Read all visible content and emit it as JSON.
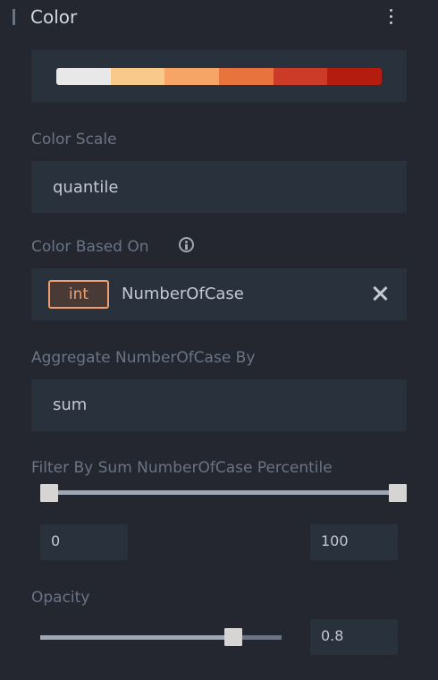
{
  "header": {
    "title": "Color"
  },
  "color_ramp": {
    "colors": [
      "#e8e8e8",
      "#f8c98a",
      "#f6a566",
      "#e8733d",
      "#cc3b27",
      "#b41c10"
    ]
  },
  "color_scale": {
    "label": "Color Scale",
    "value": "quantile"
  },
  "color_based_on": {
    "label": "Color Based On",
    "field_type": "int",
    "field_name": "NumberOfCase"
  },
  "aggregate": {
    "label": "Aggregate NumberOfCase By",
    "value": "sum"
  },
  "filter": {
    "label": "Filter By Sum NumberOfCase Percentile",
    "min_value": "0",
    "max_value": "100",
    "range_low": 0,
    "range_high": 100
  },
  "opacity": {
    "label": "Opacity",
    "value": "0.8",
    "level": 0.8
  }
}
